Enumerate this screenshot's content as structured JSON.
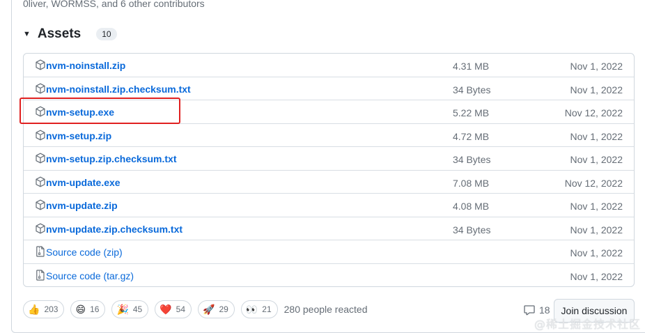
{
  "contributors_text": "0liver, WORMSS, and 6 other contributors",
  "assets": {
    "title": "Assets",
    "count": "10",
    "rows": [
      {
        "icon": "package-icon",
        "name": "nvm-noinstall.zip",
        "ext": "",
        "size": "4.31 MB",
        "date": "Nov 1, 2022"
      },
      {
        "icon": "package-icon",
        "name": "nvm-noinstall.zip.checksum.txt",
        "ext": "",
        "size": "34 Bytes",
        "date": "Nov 1, 2022"
      },
      {
        "icon": "package-icon",
        "name": "nvm-setup.exe",
        "ext": "",
        "size": "5.22 MB",
        "date": "Nov 12, 2022"
      },
      {
        "icon": "package-icon",
        "name": "nvm-setup.zip",
        "ext": "",
        "size": "4.72 MB",
        "date": "Nov 1, 2022"
      },
      {
        "icon": "package-icon",
        "name": "nvm-setup.zip.checksum.txt",
        "ext": "",
        "size": "34 Bytes",
        "date": "Nov 1, 2022"
      },
      {
        "icon": "package-icon",
        "name": "nvm-update.exe",
        "ext": "",
        "size": "7.08 MB",
        "date": "Nov 12, 2022"
      },
      {
        "icon": "package-icon",
        "name": "nvm-update.zip",
        "ext": "",
        "size": "4.08 MB",
        "date": "Nov 1, 2022"
      },
      {
        "icon": "package-icon",
        "name": "nvm-update.zip.checksum.txt",
        "ext": "",
        "size": "34 Bytes",
        "date": "Nov 1, 2022"
      },
      {
        "icon": "file-zip-icon",
        "name": "Source code",
        "ext": " (zip)",
        "size": "",
        "date": "Nov 1, 2022"
      },
      {
        "icon": "file-zip-icon",
        "name": "Source code",
        "ext": " (tar.gz)",
        "size": "",
        "date": "Nov 1, 2022"
      }
    ]
  },
  "reactions": [
    {
      "emoji": "👍",
      "icon": "thumbs-up-icon",
      "count": "203"
    },
    {
      "emoji": "😄",
      "icon": "smile-icon",
      "count": "16"
    },
    {
      "emoji": "🎉",
      "icon": "tada-icon",
      "count": "45"
    },
    {
      "emoji": "❤️",
      "icon": "heart-icon",
      "count": "54"
    },
    {
      "emoji": "🚀",
      "icon": "rocket-icon",
      "count": "29"
    },
    {
      "emoji": "👀",
      "icon": "eyes-icon",
      "count": "21"
    }
  ],
  "reacted_text": "280 people reacted",
  "comments_count": "18",
  "join_discussion_label": "Join discussion",
  "watermark": "@稀土掘金技术社区",
  "colors": {
    "link": "#0969da",
    "muted": "#656d76",
    "border": "#d0d7de",
    "highlight_box": "#e02020"
  }
}
